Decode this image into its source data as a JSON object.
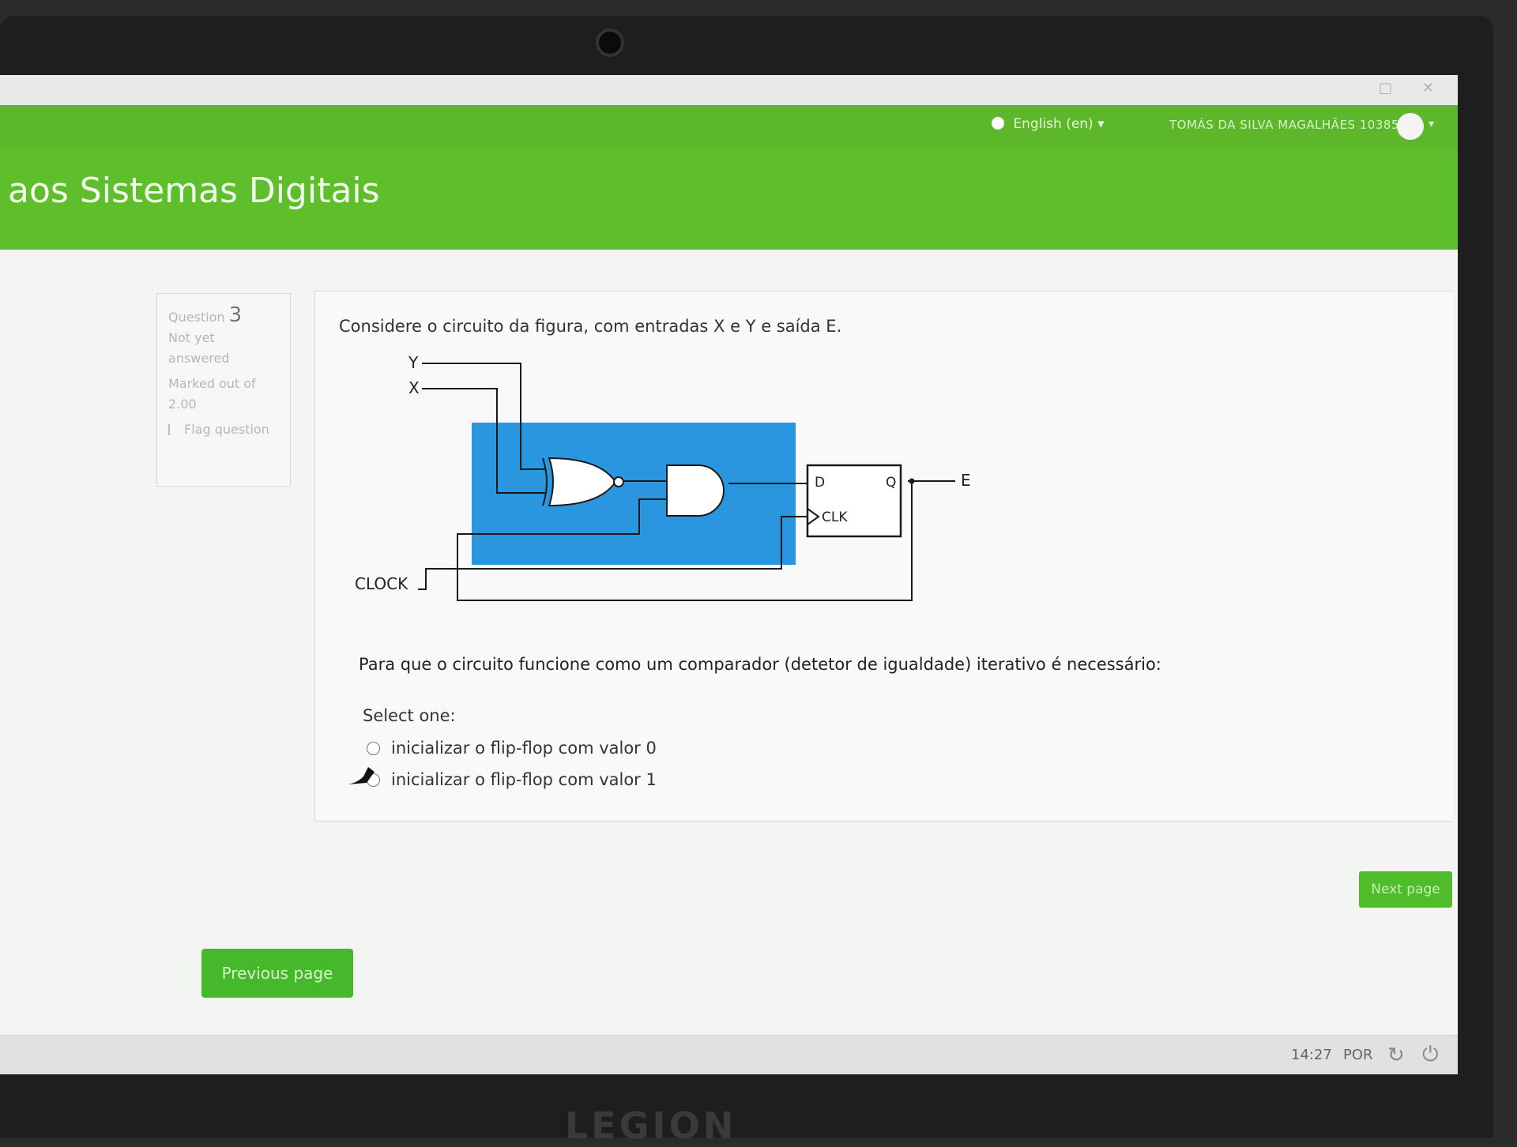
{
  "nav": {
    "language": "English (en) ▾",
    "username": "TOMÁS DA SILVA MAGALHÃES 103850"
  },
  "header": {
    "course_title": "aos Sistemas Digitais"
  },
  "question_info": {
    "label": "Question",
    "number": "3",
    "status": "Not yet answered",
    "marked": "Marked out of 2.00",
    "flag": "Flag question"
  },
  "question": {
    "text": "Considere o circuito da figura, com entradas X e Y e saída E.",
    "prompt": "Para que o circuito funcione como um comparador (detetor de igualdade) iterativo é necessário:",
    "select_label": "Select one:",
    "options": [
      "inicializar o flip-flop com valor 0",
      "inicializar o flip-flop com valor 1"
    ]
  },
  "circuit": {
    "input_y": "Y",
    "input_x": "X",
    "clock": "CLOCK",
    "ff_d": "D",
    "ff_q": "Q",
    "ff_clk": "CLK",
    "output": "E",
    "highlight_color": "#2a96e0"
  },
  "buttons": {
    "next": "Next page",
    "previous": "Previous page"
  },
  "taskbar": {
    "time": "14:27",
    "language": "POR"
  },
  "laptop": {
    "brand": "LEGION"
  }
}
